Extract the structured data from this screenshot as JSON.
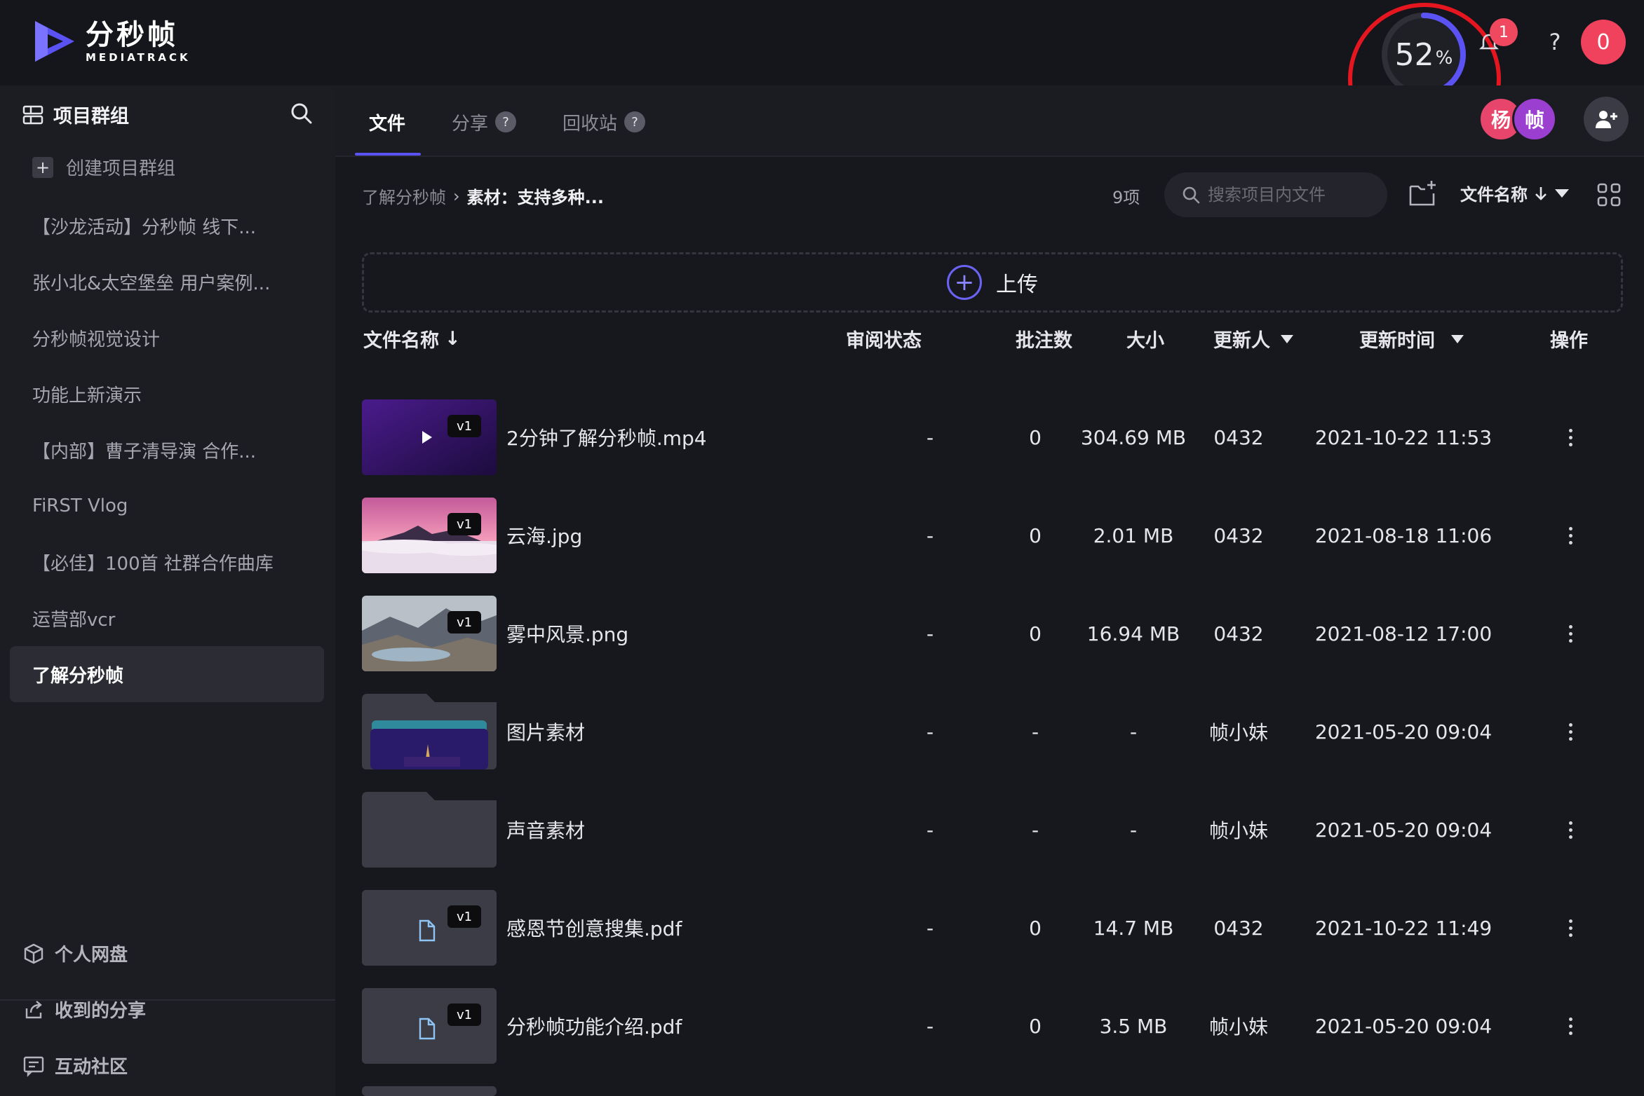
{
  "brand": {
    "name_cn": "分秒帧",
    "name_en": "MEDIATRACK",
    "color": "#5b52f3"
  },
  "header": {
    "progress": {
      "value": 52,
      "percent_sign": "%"
    },
    "notifications": {
      "count": "1"
    },
    "help": "?",
    "user_initial": "0"
  },
  "sidebar": {
    "title": "项目群组",
    "create_label": "创建项目群组",
    "items": [
      {
        "label": "【沙龙活动】分秒帧 线下..."
      },
      {
        "label": "张小北&太空堡垒 用户案例..."
      },
      {
        "label": "分秒帧视觉设计"
      },
      {
        "label": "功能上新演示"
      },
      {
        "label": "【内部】曹子清导演 合作..."
      },
      {
        "label": "FiRST Vlog"
      },
      {
        "label": "【必佳】100首 社群合作曲库"
      },
      {
        "label": "运营部vcr"
      },
      {
        "label": "了解分秒帧",
        "active": true
      }
    ],
    "bottom": [
      {
        "label": "个人网盘",
        "icon": "cube-icon"
      },
      {
        "label": "收到的分享",
        "icon": "share-icon"
      },
      {
        "label": "互动社区",
        "icon": "chat-icon"
      }
    ]
  },
  "tabs": [
    {
      "label": "文件",
      "active": true
    },
    {
      "label": "分享",
      "help": "?"
    },
    {
      "label": "回收站",
      "help": "?"
    }
  ],
  "members": [
    {
      "initial": "杨",
      "color": "#e8456c"
    },
    {
      "initial": "帧",
      "color": "#9b3fd1"
    }
  ],
  "toolbar": {
    "breadcrumb": {
      "parent": "了解分秒帧",
      "current": "素材：支持多种..."
    },
    "item_count": "9项",
    "search_placeholder": "搜索项目内文件",
    "sort_label": "文件名称"
  },
  "upload": {
    "label": "上传",
    "plus": "+"
  },
  "table": {
    "headers": {
      "name": "文件名称",
      "review": "审阅状态",
      "comments": "批注数",
      "size": "大小",
      "updater": "更新人",
      "updated": "更新时间",
      "actions": "操作"
    },
    "rows": [
      {
        "name": "2分钟了解分秒帧.mp4",
        "version": "v1",
        "review": "-",
        "comments": "0",
        "size": "304.69 MB",
        "updater": "0432",
        "updated": "2021-10-22 11:53",
        "thumb": "video"
      },
      {
        "name": "云海.jpg",
        "version": "v1",
        "review": "-",
        "comments": "0",
        "size": "2.01 MB",
        "updater": "0432",
        "updated": "2021-08-18 11:06",
        "thumb": "clouds"
      },
      {
        "name": "雾中风景.png",
        "version": "v1",
        "review": "-",
        "comments": "0",
        "size": "16.94 MB",
        "updater": "0432",
        "updated": "2021-08-12 17:00",
        "thumb": "mountain"
      },
      {
        "name": "图片素材",
        "review": "-",
        "comments": "-",
        "size": "-",
        "updater": "帧小妹",
        "updated": "2021-05-20 09:04",
        "thumb": "folder-image"
      },
      {
        "name": "声音素材",
        "review": "-",
        "comments": "-",
        "size": "-",
        "updater": "帧小妹",
        "updated": "2021-05-20 09:04",
        "thumb": "folder"
      },
      {
        "name": "感恩节创意搜集.pdf",
        "version": "v1",
        "review": "-",
        "comments": "0",
        "size": "14.7 MB",
        "updater": "0432",
        "updated": "2021-10-22 11:49",
        "thumb": "document"
      },
      {
        "name": "分秒帧功能介绍.pdf",
        "version": "v1",
        "review": "-",
        "comments": "0",
        "size": "3.5 MB",
        "updater": "帧小妹",
        "updated": "2021-05-20 09:04",
        "thumb": "document"
      }
    ]
  }
}
